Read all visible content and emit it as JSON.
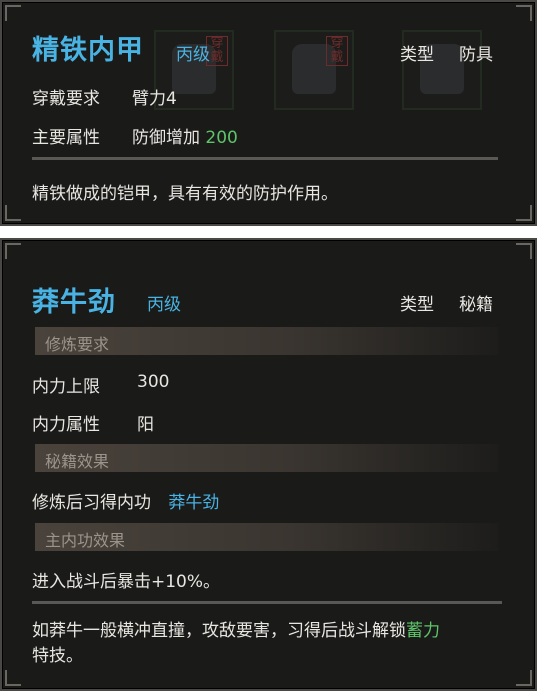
{
  "armor_card": {
    "name": "精铁内甲",
    "grade": "丙级",
    "type_label": "类型",
    "type_value": "防具",
    "requirement_label": "穿戴要求",
    "requirement_value": "臂力4",
    "attribute_label": "主要属性",
    "attribute_value": "防御增加",
    "attribute_number": "200",
    "description": "精铁做成的铠甲，具有有效的防护作用。",
    "slot_stamp": "穿戴",
    "slot_icon": "armor-icon"
  },
  "manual_card": {
    "name": "莽牛劲",
    "grade": "丙级",
    "type_label": "类型",
    "type_value": "秘籍",
    "section_requirements": "修炼要求",
    "inner_limit_label": "内力上限",
    "inner_limit_value": "300",
    "inner_attr_label": "内力属性",
    "inner_attr_value": "阳",
    "section_effect": "秘籍效果",
    "learn_label": "修炼后习得内功",
    "learn_value": "莽牛劲",
    "section_main": "主内功效果",
    "main_effect": "进入战斗后暴击+10%。",
    "description_part1": "如莽牛一般横冲直撞，攻敌要害，习得后战斗解锁",
    "description_highlight": "蓄力",
    "description_part2": "特技。"
  },
  "colors": {
    "title": "#49b3e3",
    "highlight_green": "#5ec46a",
    "panel_bg": "#1a1a19",
    "text": "#e8e6e1"
  }
}
